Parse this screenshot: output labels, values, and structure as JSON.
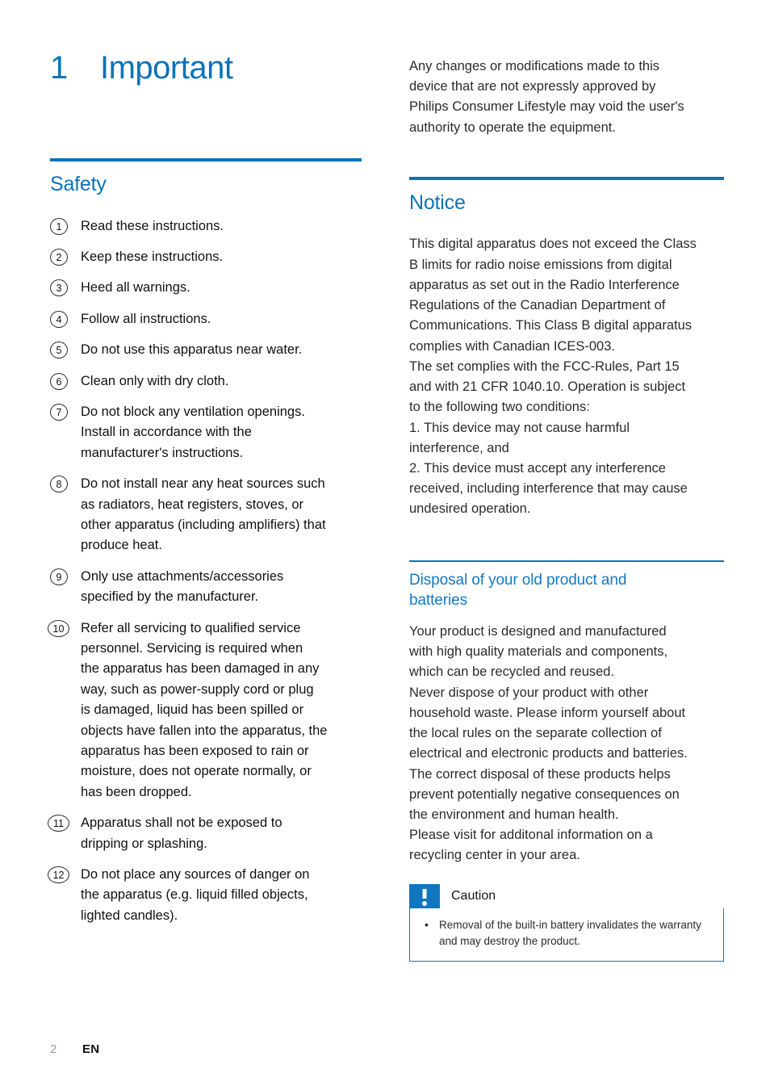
{
  "chapter": {
    "number": "1",
    "title": "Important"
  },
  "left_column": {
    "section_heading": "Safety",
    "safety_items": [
      {
        "number": "1",
        "lines": [
          "Read these instructions."
        ]
      },
      {
        "number": "2",
        "lines": [
          "Keep these instructions."
        ]
      },
      {
        "number": "3",
        "lines": [
          "Heed all warnings."
        ]
      },
      {
        "number": "4",
        "lines": [
          "Follow all instructions."
        ]
      },
      {
        "number": "5",
        "lines": [
          "Do not use this apparatus near water."
        ]
      },
      {
        "number": "6",
        "lines": [
          "Clean only with dry cloth."
        ]
      },
      {
        "number": "7",
        "lines": [
          "Do not block any ventilation openings.",
          "Install in accordance with the",
          "manufacturer's instructions."
        ]
      },
      {
        "number": "8",
        "lines": [
          "Do not install near any heat sources such",
          "as radiators, heat registers, stoves, or",
          "other apparatus (including amplifiers) that",
          "produce heat."
        ]
      },
      {
        "number": "9",
        "lines": [
          "Only use attachments/accessories",
          "specified by the manufacturer."
        ]
      },
      {
        "number": "10",
        "lines": [
          "Refer all servicing to qualified service",
          "personnel. Servicing is required when",
          "the apparatus has been damaged in any",
          "way, such as power-supply cord or plug",
          "is damaged, liquid has been spilled or",
          "objects have fallen into the apparatus, the",
          "apparatus has been exposed to rain or",
          "moisture, does not operate normally, or",
          "has been dropped."
        ]
      },
      {
        "number": "11",
        "lines": [
          "Apparatus shall not be exposed to",
          "dripping or splashing."
        ]
      },
      {
        "number": "12",
        "lines": [
          "Do not place any sources of danger on",
          "the apparatus (e.g. liquid filled objects,",
          "lighted candles)."
        ]
      }
    ]
  },
  "right_column": {
    "intro_paragraph": [
      "Any changes or modifications made to this",
      "device that are not expressly approved by",
      "Philips Consumer Lifestyle may void the user's",
      "authority to operate the equipment."
    ],
    "notice_heading": "Notice",
    "notice_paragraph": [
      "This digital apparatus does not exceed the Class",
      "B limits for radio noise emissions from digital",
      "apparatus as set out in the Radio Interference",
      "Regulations of the Canadian Department of",
      "Communications. This Class B digital apparatus",
      "complies with Canadian ICES-003.",
      "The set complies with the FCC-Rules, Part 15",
      "and with 21 CFR 1040.10. Operation is subject",
      "to the following two conditions:",
      "1. This device may not cause harmful",
      "interference, and",
      "2. This device must accept any interference",
      "received, including interference that may cause",
      "undesired operation."
    ],
    "disposal_heading": [
      "Disposal of your old product and",
      "batteries"
    ],
    "disposal_paragraph": [
      "Your product is designed and manufactured",
      "with high quality materials and components,",
      "which can be recycled and reused.",
      "Never dispose of your product with other",
      "household waste. Please inform yourself about",
      "the local rules on the separate collection of",
      "electrical and electronic products and batteries.",
      "The correct disposal of these products helps",
      "prevent potentially negative consequences on",
      "the environment and human health.",
      "Please visit for additonal information on a",
      "recycling center in your area."
    ],
    "caution": {
      "icon": "exclamation-icon",
      "title": "Caution",
      "bullet_lines": [
        "Removal of the built-in battery invalidates the warranty",
        "and may destroy the product."
      ]
    }
  },
  "footer": {
    "page_number": "2",
    "language": "EN"
  },
  "colors": {
    "brand_blue": "#0b72b8",
    "sub_heading_blue": "#1479c4",
    "caution_blue": "#1176bd",
    "body_text": "#2b2b2b",
    "page_number_gray": "#9a9a9a"
  }
}
